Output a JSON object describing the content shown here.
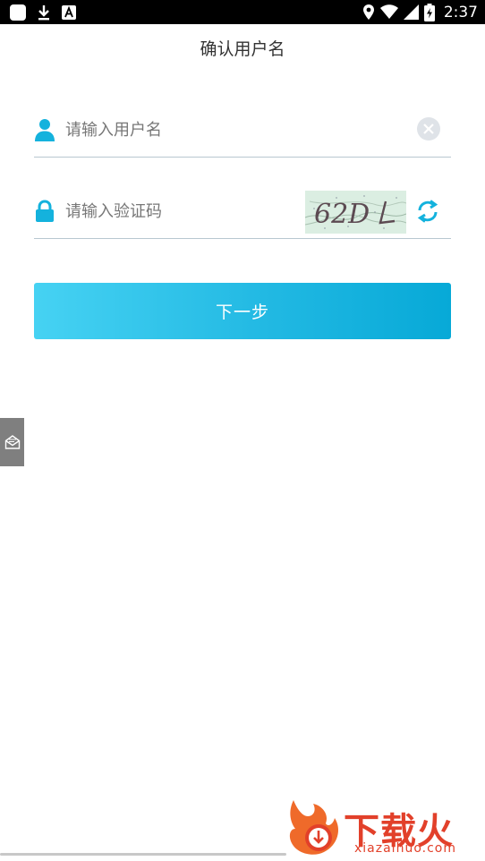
{
  "status_bar": {
    "time": "2:37",
    "icons": [
      "app-square-icon",
      "download-icon",
      "font-app-icon",
      "location-icon",
      "wifi-icon",
      "signal-icon",
      "battery-charging-icon"
    ]
  },
  "page": {
    "title": "确认用户名"
  },
  "form": {
    "username": {
      "placeholder": "请输入用户名",
      "value": "",
      "icon": "user-icon"
    },
    "captcha": {
      "placeholder": "请输入验证码",
      "value": "",
      "icon": "lock-icon",
      "image_text": "62D"
    },
    "next_button": "下一步"
  },
  "watermark": {
    "brand": "下载火",
    "domain": "xiazaihuo.com"
  },
  "colors": {
    "accent": "#14b2dd",
    "button_start": "#46d2f3",
    "button_end": "#07a9d7",
    "watermark": "#e2402a"
  }
}
